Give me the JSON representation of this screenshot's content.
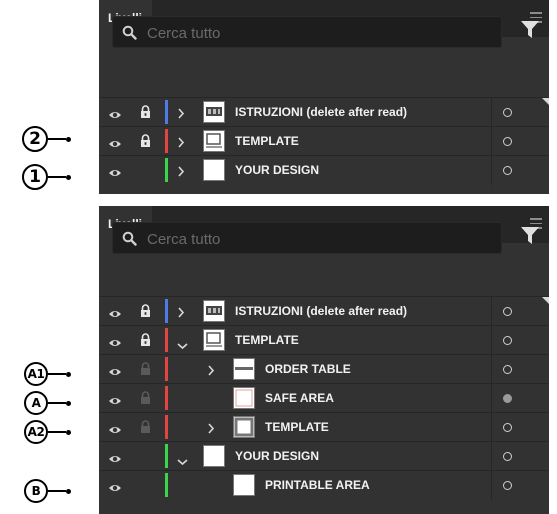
{
  "panels": [
    {
      "tab": "Livelli",
      "search": {
        "placeholder": "Cerca tutto"
      },
      "layers": [
        {
          "name": "ISTRUZIONI (delete after read)",
          "color": "#4f7bea",
          "expanded": false,
          "locked": true,
          "has_children": true,
          "thumb": "instructions",
          "indent": 0,
          "target_filled": false
        },
        {
          "name": "TEMPLATE",
          "color": "#e2443f",
          "expanded": false,
          "locked": true,
          "has_children": true,
          "thumb": "template",
          "indent": 0,
          "target_filled": false
        },
        {
          "name": "YOUR DESIGN",
          "color": "#39d64a",
          "expanded": false,
          "locked": false,
          "has_children": true,
          "thumb": "blank",
          "indent": 0,
          "target_filled": false
        }
      ]
    },
    {
      "tab": "Livelli",
      "search": {
        "placeholder": "Cerca tutto"
      },
      "layers": [
        {
          "name": "ISTRUZIONI (delete after read)",
          "color": "#4f7bea",
          "expanded": false,
          "locked": true,
          "has_children": true,
          "thumb": "instructions",
          "indent": 0,
          "target_filled": false
        },
        {
          "name": "TEMPLATE",
          "color": "#e2443f",
          "expanded": true,
          "locked": true,
          "has_children": true,
          "thumb": "template",
          "indent": 0,
          "target_filled": false
        },
        {
          "name": "ORDER TABLE",
          "color": "#e2443f",
          "expanded": false,
          "locked": "inherited",
          "has_children": true,
          "thumb": "table",
          "indent": 1,
          "target_filled": false
        },
        {
          "name": "SAFE AREA",
          "color": "#e2443f",
          "expanded": false,
          "locked": "inherited",
          "has_children": false,
          "thumb": "safe",
          "indent": 1,
          "target_filled": true
        },
        {
          "name": "TEMPLATE",
          "color": "#e2443f",
          "expanded": false,
          "locked": "inherited",
          "has_children": true,
          "thumb": "frame",
          "indent": 1,
          "target_filled": false
        },
        {
          "name": "YOUR DESIGN",
          "color": "#39d64a",
          "expanded": true,
          "locked": false,
          "has_children": true,
          "thumb": "blank",
          "indent": 0,
          "target_filled": false
        },
        {
          "name": "PRINTABLE AREA",
          "color": "#39d64a",
          "expanded": false,
          "locked": false,
          "has_children": false,
          "thumb": "blank",
          "indent": 1,
          "target_filled": false
        }
      ]
    }
  ],
  "callouts": {
    "top": [
      "2",
      "1"
    ],
    "bottom": [
      "A1",
      "A",
      "A2",
      "B"
    ]
  }
}
